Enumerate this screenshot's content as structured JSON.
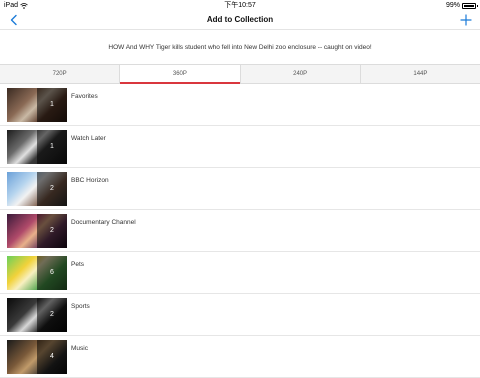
{
  "status_bar": {
    "device": "iPad",
    "time": "下午10:57",
    "battery": "99%"
  },
  "nav": {
    "title": "Add to Collection",
    "back_icon": "chevron-left-icon",
    "add_icon": "plus-icon",
    "accent_color": "#1a7ad8"
  },
  "video_title": "HOW And WHY Tiger kills student who fell into New Delhi zoo enclosure -- caught on video!",
  "tabs": [
    {
      "label": "720P"
    },
    {
      "label": "360P"
    },
    {
      "label": "240P"
    },
    {
      "label": "144P"
    }
  ],
  "active_tab": "360P",
  "active_tab_color": "#d9363e",
  "collections": [
    {
      "name": "Favorites",
      "count": "1"
    },
    {
      "name": "Watch Later",
      "count": "1"
    },
    {
      "name": "BBC Horizon",
      "count": "2"
    },
    {
      "name": "Documentary Channel",
      "count": "2"
    },
    {
      "name": "Pets",
      "count": "6"
    },
    {
      "name": "Sports",
      "count": "2"
    },
    {
      "name": "Music",
      "count": "4"
    }
  ]
}
